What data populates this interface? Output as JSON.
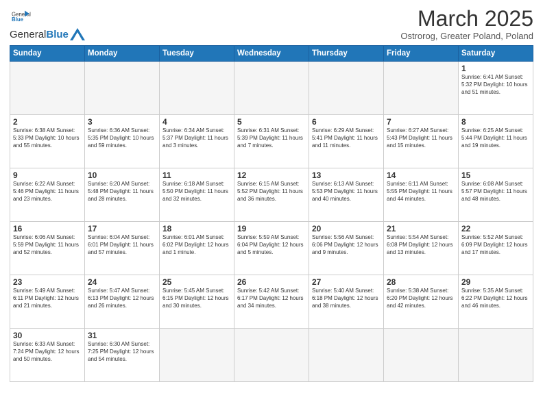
{
  "header": {
    "logo_general": "General",
    "logo_blue": "Blue",
    "month_title": "March 2025",
    "subtitle": "Ostrorog, Greater Poland, Poland"
  },
  "weekdays": [
    "Sunday",
    "Monday",
    "Tuesday",
    "Wednesday",
    "Thursday",
    "Friday",
    "Saturday"
  ],
  "weeks": [
    [
      {
        "day": "",
        "info": ""
      },
      {
        "day": "",
        "info": ""
      },
      {
        "day": "",
        "info": ""
      },
      {
        "day": "",
        "info": ""
      },
      {
        "day": "",
        "info": ""
      },
      {
        "day": "",
        "info": ""
      },
      {
        "day": "1",
        "info": "Sunrise: 6:41 AM\nSunset: 5:32 PM\nDaylight: 10 hours and 51 minutes."
      }
    ],
    [
      {
        "day": "2",
        "info": "Sunrise: 6:38 AM\nSunset: 5:33 PM\nDaylight: 10 hours and 55 minutes."
      },
      {
        "day": "3",
        "info": "Sunrise: 6:36 AM\nSunset: 5:35 PM\nDaylight: 10 hours and 59 minutes."
      },
      {
        "day": "4",
        "info": "Sunrise: 6:34 AM\nSunset: 5:37 PM\nDaylight: 11 hours and 3 minutes."
      },
      {
        "day": "5",
        "info": "Sunrise: 6:31 AM\nSunset: 5:39 PM\nDaylight: 11 hours and 7 minutes."
      },
      {
        "day": "6",
        "info": "Sunrise: 6:29 AM\nSunset: 5:41 PM\nDaylight: 11 hours and 11 minutes."
      },
      {
        "day": "7",
        "info": "Sunrise: 6:27 AM\nSunset: 5:43 PM\nDaylight: 11 hours and 15 minutes."
      },
      {
        "day": "8",
        "info": "Sunrise: 6:25 AM\nSunset: 5:44 PM\nDaylight: 11 hours and 19 minutes."
      }
    ],
    [
      {
        "day": "9",
        "info": "Sunrise: 6:22 AM\nSunset: 5:46 PM\nDaylight: 11 hours and 23 minutes."
      },
      {
        "day": "10",
        "info": "Sunrise: 6:20 AM\nSunset: 5:48 PM\nDaylight: 11 hours and 28 minutes."
      },
      {
        "day": "11",
        "info": "Sunrise: 6:18 AM\nSunset: 5:50 PM\nDaylight: 11 hours and 32 minutes."
      },
      {
        "day": "12",
        "info": "Sunrise: 6:15 AM\nSunset: 5:52 PM\nDaylight: 11 hours and 36 minutes."
      },
      {
        "day": "13",
        "info": "Sunrise: 6:13 AM\nSunset: 5:53 PM\nDaylight: 11 hours and 40 minutes."
      },
      {
        "day": "14",
        "info": "Sunrise: 6:11 AM\nSunset: 5:55 PM\nDaylight: 11 hours and 44 minutes."
      },
      {
        "day": "15",
        "info": "Sunrise: 6:08 AM\nSunset: 5:57 PM\nDaylight: 11 hours and 48 minutes."
      }
    ],
    [
      {
        "day": "16",
        "info": "Sunrise: 6:06 AM\nSunset: 5:59 PM\nDaylight: 11 hours and 52 minutes."
      },
      {
        "day": "17",
        "info": "Sunrise: 6:04 AM\nSunset: 6:01 PM\nDaylight: 11 hours and 57 minutes."
      },
      {
        "day": "18",
        "info": "Sunrise: 6:01 AM\nSunset: 6:02 PM\nDaylight: 12 hours and 1 minute."
      },
      {
        "day": "19",
        "info": "Sunrise: 5:59 AM\nSunset: 6:04 PM\nDaylight: 12 hours and 5 minutes."
      },
      {
        "day": "20",
        "info": "Sunrise: 5:56 AM\nSunset: 6:06 PM\nDaylight: 12 hours and 9 minutes."
      },
      {
        "day": "21",
        "info": "Sunrise: 5:54 AM\nSunset: 6:08 PM\nDaylight: 12 hours and 13 minutes."
      },
      {
        "day": "22",
        "info": "Sunrise: 5:52 AM\nSunset: 6:09 PM\nDaylight: 12 hours and 17 minutes."
      }
    ],
    [
      {
        "day": "23",
        "info": "Sunrise: 5:49 AM\nSunset: 6:11 PM\nDaylight: 12 hours and 21 minutes."
      },
      {
        "day": "24",
        "info": "Sunrise: 5:47 AM\nSunset: 6:13 PM\nDaylight: 12 hours and 26 minutes."
      },
      {
        "day": "25",
        "info": "Sunrise: 5:45 AM\nSunset: 6:15 PM\nDaylight: 12 hours and 30 minutes."
      },
      {
        "day": "26",
        "info": "Sunrise: 5:42 AM\nSunset: 6:17 PM\nDaylight: 12 hours and 34 minutes."
      },
      {
        "day": "27",
        "info": "Sunrise: 5:40 AM\nSunset: 6:18 PM\nDaylight: 12 hours and 38 minutes."
      },
      {
        "day": "28",
        "info": "Sunrise: 5:38 AM\nSunset: 6:20 PM\nDaylight: 12 hours and 42 minutes."
      },
      {
        "day": "29",
        "info": "Sunrise: 5:35 AM\nSunset: 6:22 PM\nDaylight: 12 hours and 46 minutes."
      }
    ],
    [
      {
        "day": "30",
        "info": "Sunrise: 6:33 AM\nSunset: 7:24 PM\nDaylight: 12 hours and 50 minutes."
      },
      {
        "day": "31",
        "info": "Sunrise: 6:30 AM\nSunset: 7:25 PM\nDaylight: 12 hours and 54 minutes."
      },
      {
        "day": "",
        "info": ""
      },
      {
        "day": "",
        "info": ""
      },
      {
        "day": "",
        "info": ""
      },
      {
        "day": "",
        "info": ""
      },
      {
        "day": "",
        "info": ""
      }
    ]
  ]
}
